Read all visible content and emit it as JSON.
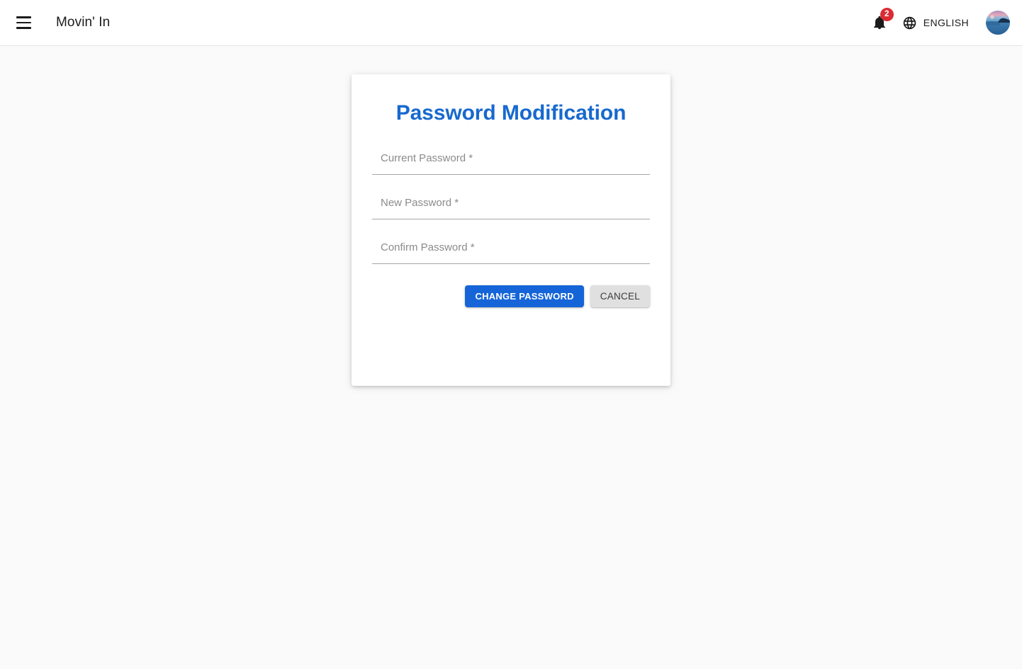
{
  "header": {
    "menu_icon": "hamburger-menu-icon",
    "brand_title": "Movin' In",
    "notifications": {
      "icon": "bell-icon",
      "badge_count": "2",
      "badge_color": "#db2b33"
    },
    "language": {
      "icon": "globe-icon",
      "label": "ENGLISH"
    },
    "avatar": {
      "icon": "user-avatar-image"
    }
  },
  "card": {
    "title": "Password Modification",
    "fields": [
      {
        "name": "current-password",
        "placeholder": "Current Password *",
        "value": ""
      },
      {
        "name": "new-password",
        "placeholder": "New Password *",
        "value": ""
      },
      {
        "name": "confirm-password",
        "placeholder": "Confirm Password *",
        "value": ""
      }
    ],
    "buttons": {
      "submit_label": "CHANGE PASSWORD",
      "cancel_label": "CANCEL"
    }
  },
  "theme": {
    "accent": "#1769ce",
    "primary_button": "#1565d8",
    "secondary_button": "#e0e0e0",
    "page_background": "#fafafa",
    "header_background": "#ffffff"
  }
}
